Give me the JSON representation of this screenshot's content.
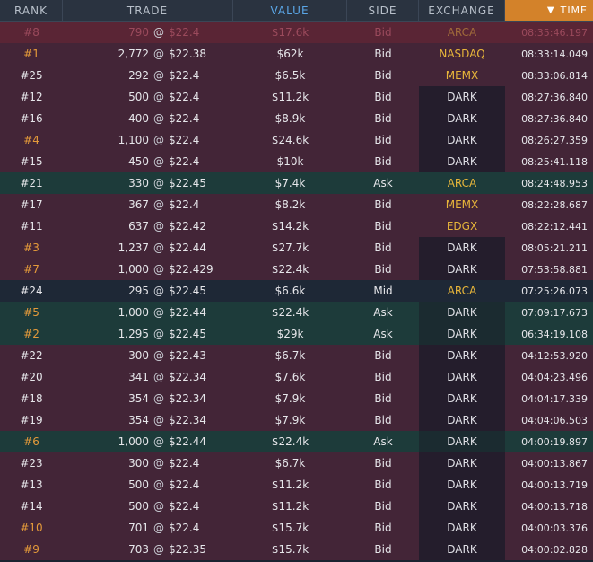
{
  "header": {
    "rank": "RANK",
    "trade": "TRADE",
    "value": "VALUE",
    "side": "SIDE",
    "exchange": "EXCHANGE",
    "time": "TIME"
  },
  "colors": {
    "bid_row": "#432537",
    "ask_row": "#1d3b3a",
    "mid_row": "#1e2836",
    "accent": "#d3822a",
    "lit_exchange": "#e8b63a"
  },
  "rows": [
    {
      "rank": "#8",
      "qty": "790",
      "price": "$22.4",
      "value": "$17.6k",
      "side": "Bid",
      "exchange": "ARCA",
      "time": "08:35:46.197",
      "type": "top",
      "hl": true
    },
    {
      "rank": "#1",
      "qty": "2,772",
      "price": "$22.38",
      "value": "$62k",
      "side": "Bid",
      "exchange": "NASDAQ",
      "time": "08:33:14.049",
      "type": "bid",
      "hl": true
    },
    {
      "rank": "#25",
      "qty": "292",
      "price": "$22.4",
      "value": "$6.5k",
      "side": "Bid",
      "exchange": "MEMX",
      "time": "08:33:06.814",
      "type": "bid",
      "hl": false
    },
    {
      "rank": "#12",
      "qty": "500",
      "price": "$22.4",
      "value": "$11.2k",
      "side": "Bid",
      "exchange": "DARK",
      "time": "08:27:36.840",
      "type": "bid",
      "hl": false
    },
    {
      "rank": "#16",
      "qty": "400",
      "price": "$22.4",
      "value": "$8.9k",
      "side": "Bid",
      "exchange": "DARK",
      "time": "08:27:36.840",
      "type": "bid",
      "hl": false
    },
    {
      "rank": "#4",
      "qty": "1,100",
      "price": "$22.4",
      "value": "$24.6k",
      "side": "Bid",
      "exchange": "DARK",
      "time": "08:26:27.359",
      "type": "bid",
      "hl": true
    },
    {
      "rank": "#15",
      "qty": "450",
      "price": "$22.4",
      "value": "$10k",
      "side": "Bid",
      "exchange": "DARK",
      "time": "08:25:41.118",
      "type": "bid",
      "hl": false
    },
    {
      "rank": "#21",
      "qty": "330",
      "price": "$22.45",
      "value": "$7.4k",
      "side": "Ask",
      "exchange": "ARCA",
      "time": "08:24:48.953",
      "type": "ask",
      "hl": false
    },
    {
      "rank": "#17",
      "qty": "367",
      "price": "$22.4",
      "value": "$8.2k",
      "side": "Bid",
      "exchange": "MEMX",
      "time": "08:22:28.687",
      "type": "bid",
      "hl": false
    },
    {
      "rank": "#11",
      "qty": "637",
      "price": "$22.42",
      "value": "$14.2k",
      "side": "Bid",
      "exchange": "EDGX",
      "time": "08:22:12.441",
      "type": "bid",
      "hl": false
    },
    {
      "rank": "#3",
      "qty": "1,237",
      "price": "$22.44",
      "value": "$27.7k",
      "side": "Bid",
      "exchange": "DARK",
      "time": "08:05:21.211",
      "type": "bid",
      "hl": true
    },
    {
      "rank": "#7",
      "qty": "1,000",
      "price": "$22.429",
      "value": "$22.4k",
      "side": "Bid",
      "exchange": "DARK",
      "time": "07:53:58.881",
      "type": "bid",
      "hl": true
    },
    {
      "rank": "#24",
      "qty": "295",
      "price": "$22.45",
      "value": "$6.6k",
      "side": "Mid",
      "exchange": "ARCA",
      "time": "07:25:26.073",
      "type": "mid",
      "hl": false
    },
    {
      "rank": "#5",
      "qty": "1,000",
      "price": "$22.44",
      "value": "$22.4k",
      "side": "Ask",
      "exchange": "DARK",
      "time": "07:09:17.673",
      "type": "ask",
      "hl": true
    },
    {
      "rank": "#2",
      "qty": "1,295",
      "price": "$22.45",
      "value": "$29k",
      "side": "Ask",
      "exchange": "DARK",
      "time": "06:34:19.108",
      "type": "ask",
      "hl": true
    },
    {
      "rank": "#22",
      "qty": "300",
      "price": "$22.43",
      "value": "$6.7k",
      "side": "Bid",
      "exchange": "DARK",
      "time": "04:12:53.920",
      "type": "bid",
      "hl": false
    },
    {
      "rank": "#20",
      "qty": "341",
      "price": "$22.34",
      "value": "$7.6k",
      "side": "Bid",
      "exchange": "DARK",
      "time": "04:04:23.496",
      "type": "bid",
      "hl": false
    },
    {
      "rank": "#18",
      "qty": "354",
      "price": "$22.34",
      "value": "$7.9k",
      "side": "Bid",
      "exchange": "DARK",
      "time": "04:04:17.339",
      "type": "bid",
      "hl": false
    },
    {
      "rank": "#19",
      "qty": "354",
      "price": "$22.34",
      "value": "$7.9k",
      "side": "Bid",
      "exchange": "DARK",
      "time": "04:04:06.503",
      "type": "bid",
      "hl": false
    },
    {
      "rank": "#6",
      "qty": "1,000",
      "price": "$22.44",
      "value": "$22.4k",
      "side": "Ask",
      "exchange": "DARK",
      "time": "04:00:19.897",
      "type": "ask",
      "hl": true
    },
    {
      "rank": "#23",
      "qty": "300",
      "price": "$22.4",
      "value": "$6.7k",
      "side": "Bid",
      "exchange": "DARK",
      "time": "04:00:13.867",
      "type": "bid",
      "hl": false
    },
    {
      "rank": "#13",
      "qty": "500",
      "price": "$22.4",
      "value": "$11.2k",
      "side": "Bid",
      "exchange": "DARK",
      "time": "04:00:13.719",
      "type": "bid",
      "hl": false
    },
    {
      "rank": "#14",
      "qty": "500",
      "price": "$22.4",
      "value": "$11.2k",
      "side": "Bid",
      "exchange": "DARK",
      "time": "04:00:13.718",
      "type": "bid",
      "hl": false
    },
    {
      "rank": "#10",
      "qty": "701",
      "price": "$22.4",
      "value": "$15.7k",
      "side": "Bid",
      "exchange": "DARK",
      "time": "04:00:03.376",
      "type": "bid",
      "hl": true
    },
    {
      "rank": "#9",
      "qty": "703",
      "price": "$22.35",
      "value": "$15.7k",
      "side": "Bid",
      "exchange": "DARK",
      "time": "04:00:02.828",
      "type": "bid",
      "hl": true
    }
  ],
  "at_symbol": "@"
}
